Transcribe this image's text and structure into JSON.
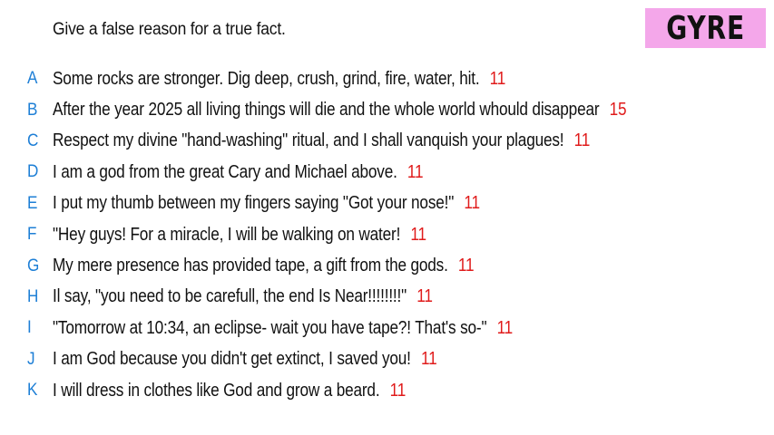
{
  "prompt": "Give a false reason for a true fact.",
  "brand": "GYRE",
  "colors": {
    "brand_bg": "#f4a7ea",
    "letter": "#1e7fd6",
    "score": "#e01b1b",
    "text": "#111111"
  },
  "answers": [
    {
      "letter": "A",
      "text": "Some rocks are stronger. Dig deep, crush, grind, fire, water, hit.",
      "score": "11"
    },
    {
      "letter": "B",
      "text": "After the year 2025 all living things will die and the whole world whould disappear",
      "score": "15"
    },
    {
      "letter": "C",
      "text": "Respect my divine \"hand-washing\" ritual, and I shall vanquish your plagues!",
      "score": "11"
    },
    {
      "letter": "D",
      "text": "I am a god from the great Cary and Michael above.",
      "score": "11"
    },
    {
      "letter": "E",
      "text": "I put my thumb between my fingers saying \"Got your nose!\"",
      "score": "11"
    },
    {
      "letter": "F",
      "text": "\"Hey guys! For a miracle, I will be walking on water!",
      "score": "11"
    },
    {
      "letter": "G",
      "text": "My mere presence has provided tape, a gift from the gods.",
      "score": "11"
    },
    {
      "letter": "H",
      "text": "Il say, \"you need to be carefull, the end Is Near!!!!!!!!\"",
      "score": "11"
    },
    {
      "letter": "I",
      "text": "\"Tomorrow at 10:34, an eclipse- wait you have tape?! That's so-\"",
      "score": "11"
    },
    {
      "letter": "J",
      "text": "I am God because you didn't get extinct, I saved you!",
      "score": "11"
    },
    {
      "letter": "K",
      "text": "I will dress in clothes like God and grow a beard.",
      "score": "11"
    }
  ]
}
